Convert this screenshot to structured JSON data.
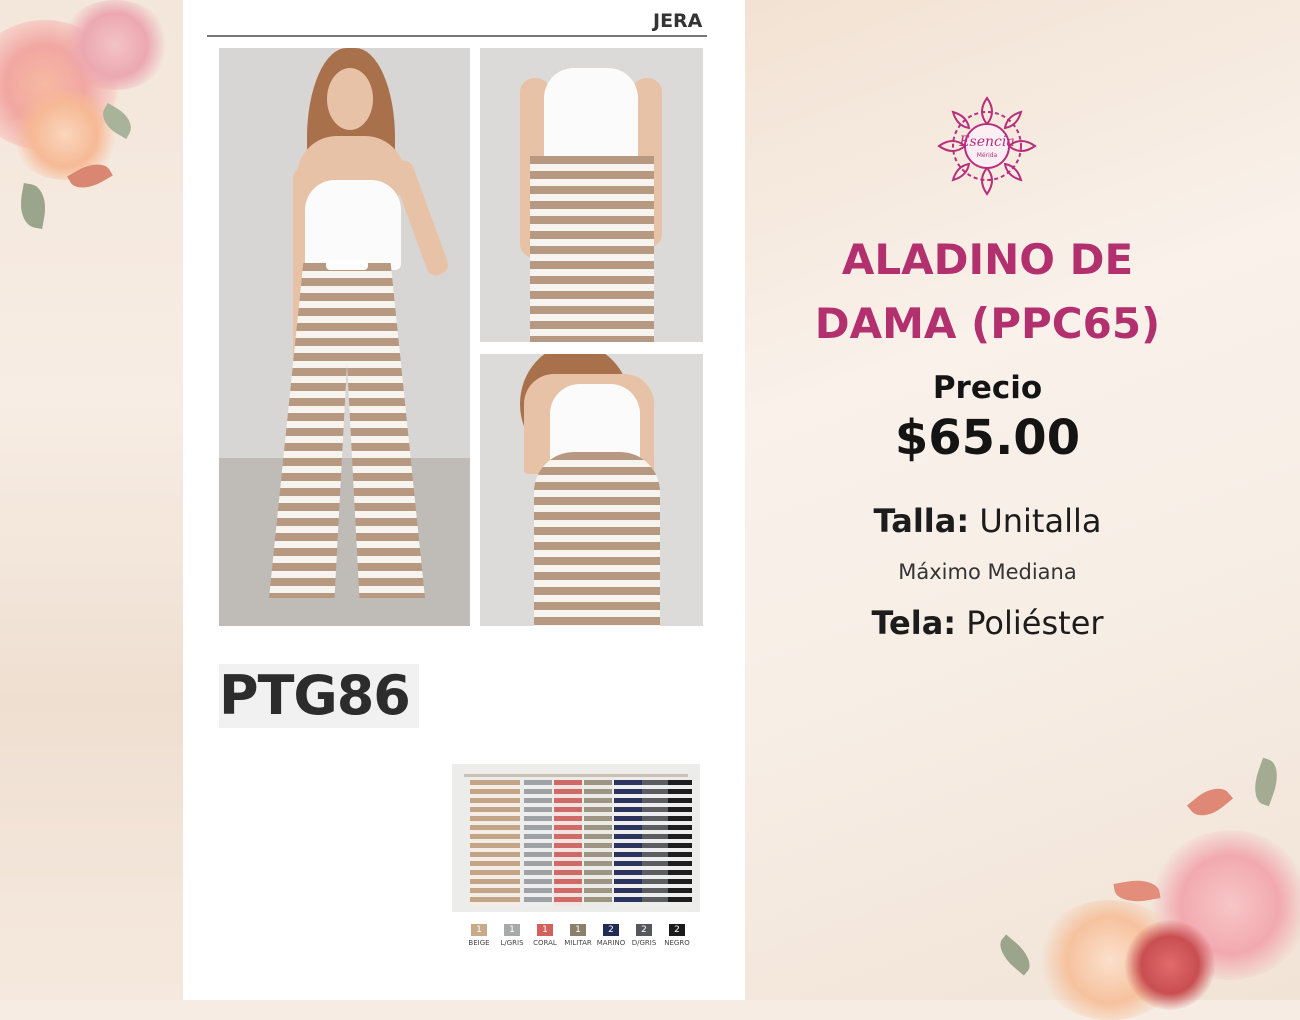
{
  "catalog": {
    "brand_label": "JERA",
    "product_code": "PTG86",
    "colors": [
      {
        "qty": "1",
        "name": "BEIGE",
        "hex": "#c8aa8a"
      },
      {
        "qty": "1",
        "name": "L/GRIS",
        "hex": "#a7a9ab"
      },
      {
        "qty": "1",
        "name": "CORAL",
        "hex": "#d2605c"
      },
      {
        "qty": "1",
        "name": "MILITAR",
        "hex": "#8a7f6a"
      },
      {
        "qty": "2",
        "name": "MARINO",
        "hex": "#1f2a55"
      },
      {
        "qty": "2",
        "name": "D/GRIS",
        "hex": "#55575b"
      },
      {
        "qty": "2",
        "name": "NEGRO",
        "hex": "#1a1a1a"
      }
    ]
  },
  "logo": {
    "name": "Esencia",
    "subtitle": "Mérida",
    "icon": "mandala-icon",
    "color": "#b72f7d"
  },
  "product": {
    "title_line1": "ALADINO DE",
    "title_line2": "DAMA (PPC65)",
    "price_label": "Precio",
    "price": "$65.00",
    "size_label": "Talla:",
    "size_value": "Unitalla",
    "size_note": "Máximo Mediana",
    "fabric_label": "Tela:",
    "fabric_value": "Poliéster",
    "title_color": "#b3306f"
  }
}
